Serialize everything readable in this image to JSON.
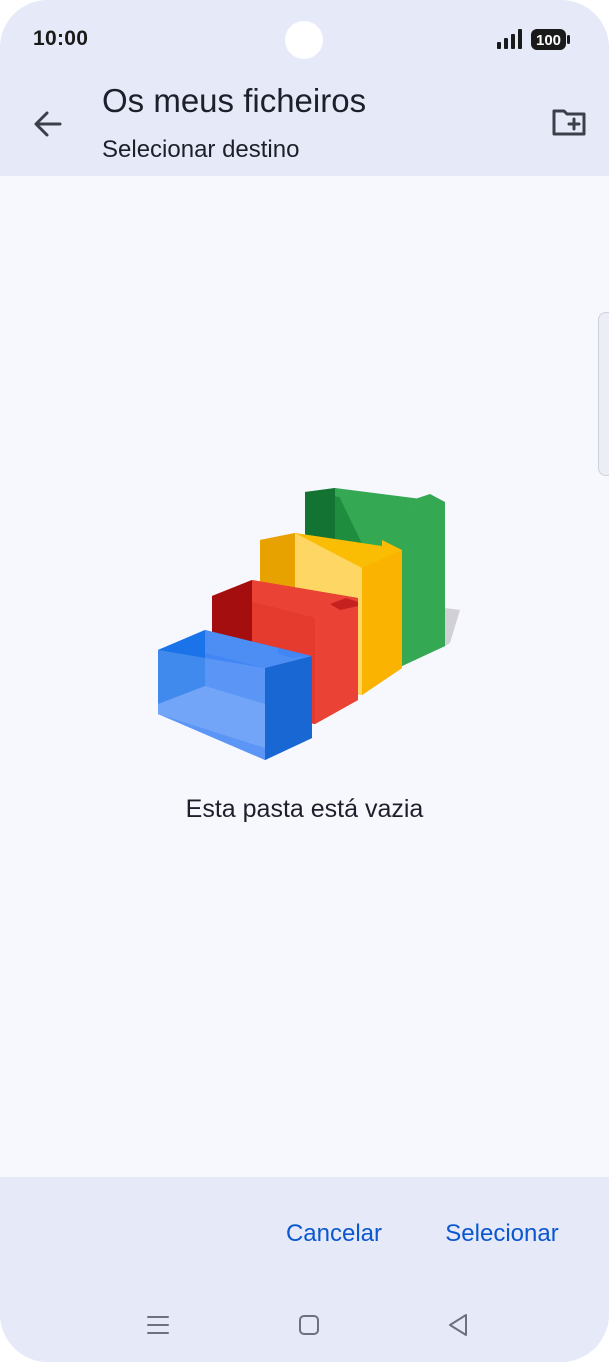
{
  "status_bar": {
    "time": "10:00",
    "battery": "100",
    "icons": [
      "signal-icon",
      "battery-icon"
    ]
  },
  "app_bar": {
    "title": "Os meus ficheiros",
    "subtitle": "Selecionar destino",
    "icons": [
      "arrow-back-icon",
      "create-new-folder-icon"
    ]
  },
  "content": {
    "empty_message": "Esta pasta está vazia",
    "illustration": "empty-folders-illustration"
  },
  "actions": {
    "cancel_label": "Cancelar",
    "select_label": "Selecionar"
  },
  "nav_bar": {
    "icons": [
      "recent-apps-icon",
      "home-icon",
      "back-icon"
    ]
  },
  "colors": {
    "surface": "#e6e9f8",
    "background": "#f7f7fe",
    "accent": "#0b57d0",
    "text": "#1d1f2a"
  }
}
